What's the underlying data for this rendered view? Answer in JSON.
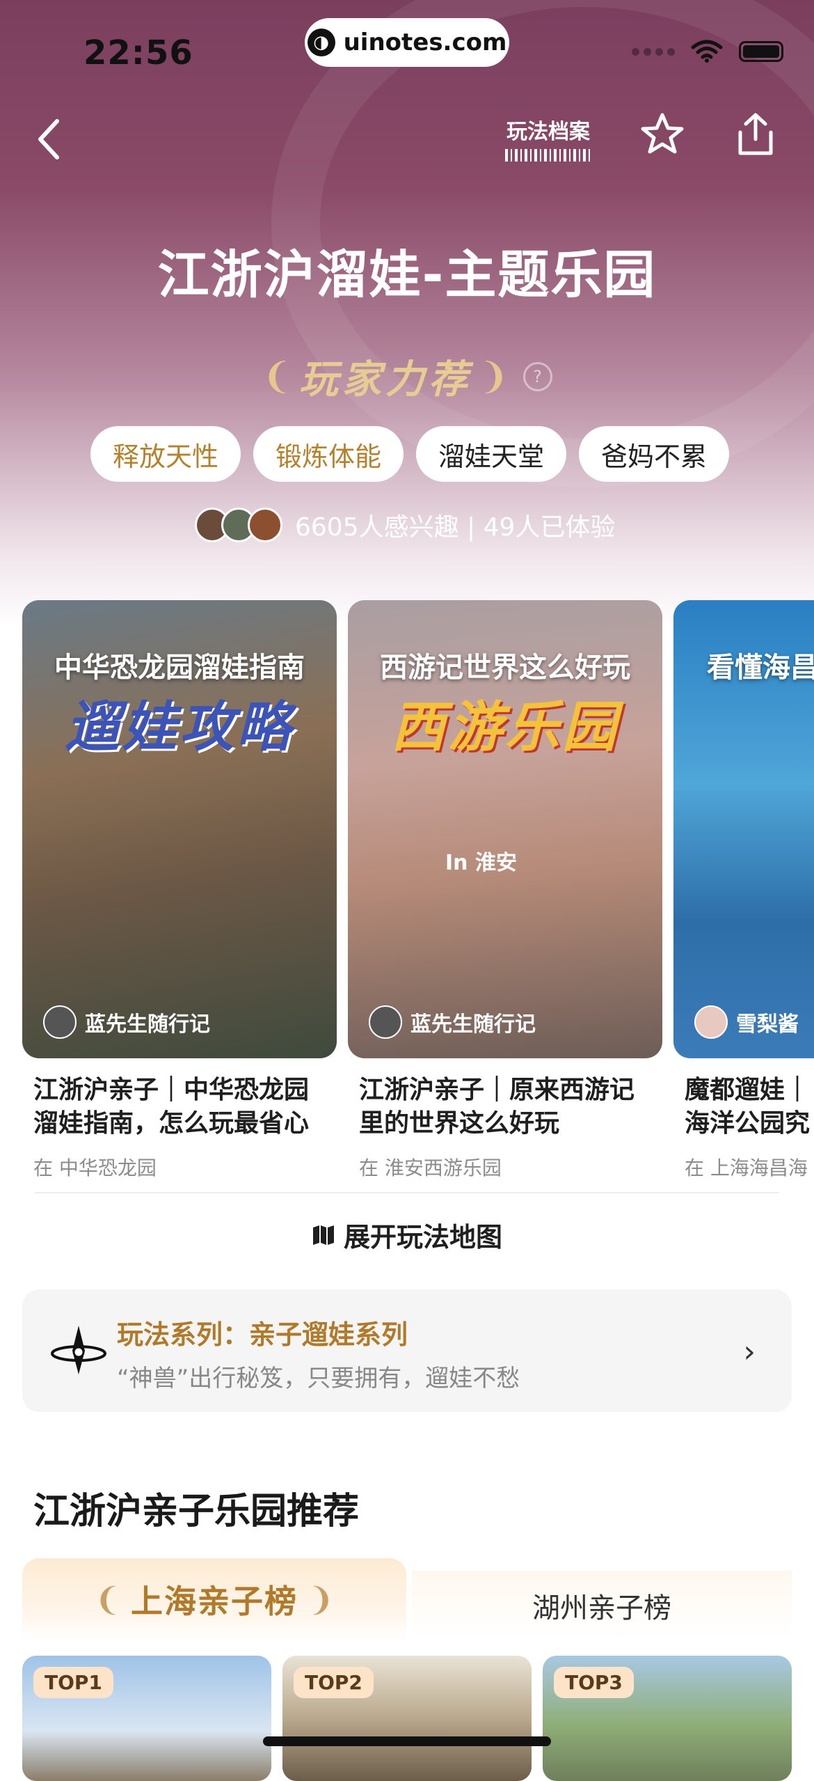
{
  "status_bar": {
    "time": "22:56",
    "url": "uinotes.com"
  },
  "header": {
    "archive_label": "玩法档案"
  },
  "hero": {
    "title": "江浙沪溜娃-主题乐园",
    "badge": "玩家力荐",
    "tags": [
      "释放天性",
      "锻炼体能",
      "溜娃天堂",
      "爸妈不累"
    ],
    "interest_text": "6605人感兴趣 | 49人已体验"
  },
  "cards": [
    {
      "overlay_title": "中华恐龙园溜娃指南",
      "overlay_big": "遛娃攻略",
      "author": "蓝先生随行记",
      "title_line1": "江浙沪亲子｜中华恐龙园",
      "title_line2": "溜娃指南，怎么玩最省心",
      "location": "在 中华恐龙园"
    },
    {
      "overlay_title": "西游记世界这么好玩",
      "overlay_big": "西游乐园",
      "overlay_tag": "In  淮安",
      "author": "蓝先生随行记",
      "title_line1": "江浙沪亲子｜原来西游记",
      "title_line2": "里的世界这么好玩",
      "location": "在 淮安西游乐园"
    },
    {
      "overlay_title": "看懂海昌",
      "author": "雪梨酱",
      "title_line1": "魔都遛娃｜",
      "title_line2": "海洋公园究",
      "location": "在 上海海昌海"
    }
  ],
  "map_link": "展开玩法地图",
  "series": {
    "name": "玩法系列：亲子遛娃系列",
    "description": "“神兽”出行秘笈，只要拥有，遛娃不愁"
  },
  "recommend": {
    "section_title": "江浙沪亲子乐园推荐",
    "tabs": [
      "上海亲子榜",
      "湖州亲子榜"
    ],
    "top_items": [
      "TOP1",
      "TOP2",
      "TOP3"
    ]
  },
  "colors": {
    "hero": "#7b3f5e",
    "gold": "#b07a2a",
    "badge_gold": "#e7cc94"
  }
}
